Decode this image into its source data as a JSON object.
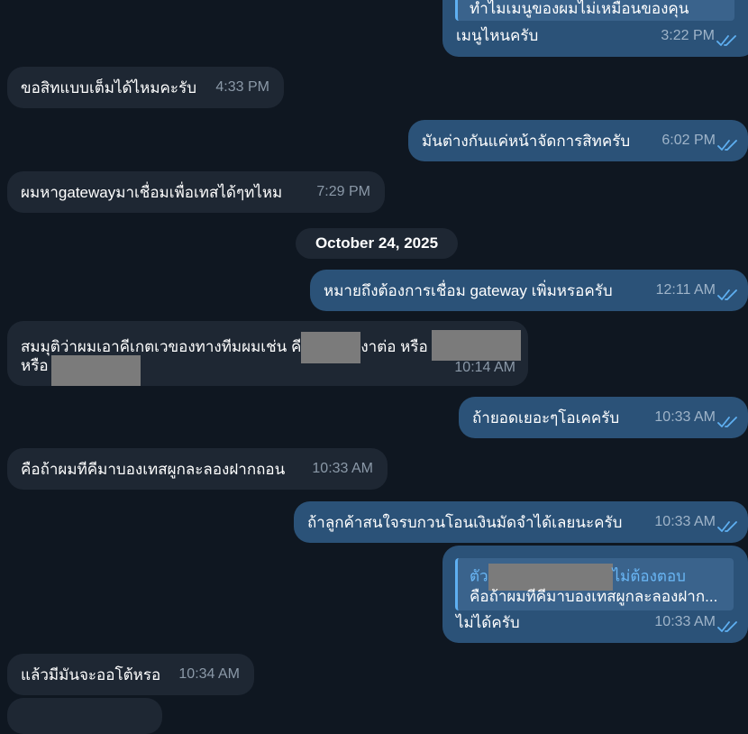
{
  "messages": [
    {
      "id": "m0",
      "direction": "out",
      "text": "เมนูไหนครับ",
      "time": "3:22 PM",
      "reply": {
        "text": "ทำไมเมนูของผมไม่เหมือนของคุน"
      }
    },
    {
      "id": "m1",
      "direction": "in",
      "text": "ขอสิทแบบเต็มได้ไหมคะรับ",
      "time": "4:33 PM"
    },
    {
      "id": "m2",
      "direction": "out",
      "text": "มันต่างกันแค่หน้าจัดการสิทครับ",
      "time": "6:02 PM"
    },
    {
      "id": "m3",
      "direction": "in",
      "text": "ผมหาgatewayมาเชื่อมเพื่อเทสได้ๆทไหม",
      "time": "7:29 PM"
    },
    {
      "id": "m4",
      "direction": "out",
      "text": "หมายถึงต้องการเชื่อม gateway เพิ่มหรอครับ",
      "time": "12:11 AM"
    },
    {
      "id": "m5",
      "direction": "in",
      "text_a": "สมมุติว่าผมเอาคีเกตเวของทางทีมผมเช่น คี",
      "text_b": "งาต่อ หรือ",
      "text_c": "หรือ",
      "time": "10:14 AM"
    },
    {
      "id": "m6",
      "direction": "out",
      "text": "ถ้ายอดเยอะๆโอเคครับ",
      "time": "10:33 AM"
    },
    {
      "id": "m7",
      "direction": "in",
      "text": "คือถ้าผมทีคีมาบองเทสผูกละลองฝากถอน",
      "time": "10:33 AM"
    },
    {
      "id": "m8",
      "direction": "out",
      "text": "ถ้าลูกค้าสนใจรบกวนโอนเงินมัดจำได้เลยนะครับ",
      "time": "10:33 AM"
    },
    {
      "id": "m9",
      "direction": "out",
      "text": "ไม่ได้ครับ",
      "time": "10:33 AM",
      "reply": {
        "prefix": "ตัว",
        "suffix": "ไม่ต้องตอบ",
        "text": "คือถ้าผมทีคีมาบองเทสผูกละลองฝาก..."
      }
    },
    {
      "id": "m10",
      "direction": "in",
      "text": "แล้วมีมันจะออโต้หรอ",
      "time": "10:34 AM"
    }
  ],
  "date_separator": "October 24, 2025",
  "colors": {
    "background": "#0f1721",
    "incoming": "#1e2733",
    "outgoing": "#2b5278",
    "reply_accent": "#5fb0f2",
    "read_ticks": "#5fb0f2"
  }
}
